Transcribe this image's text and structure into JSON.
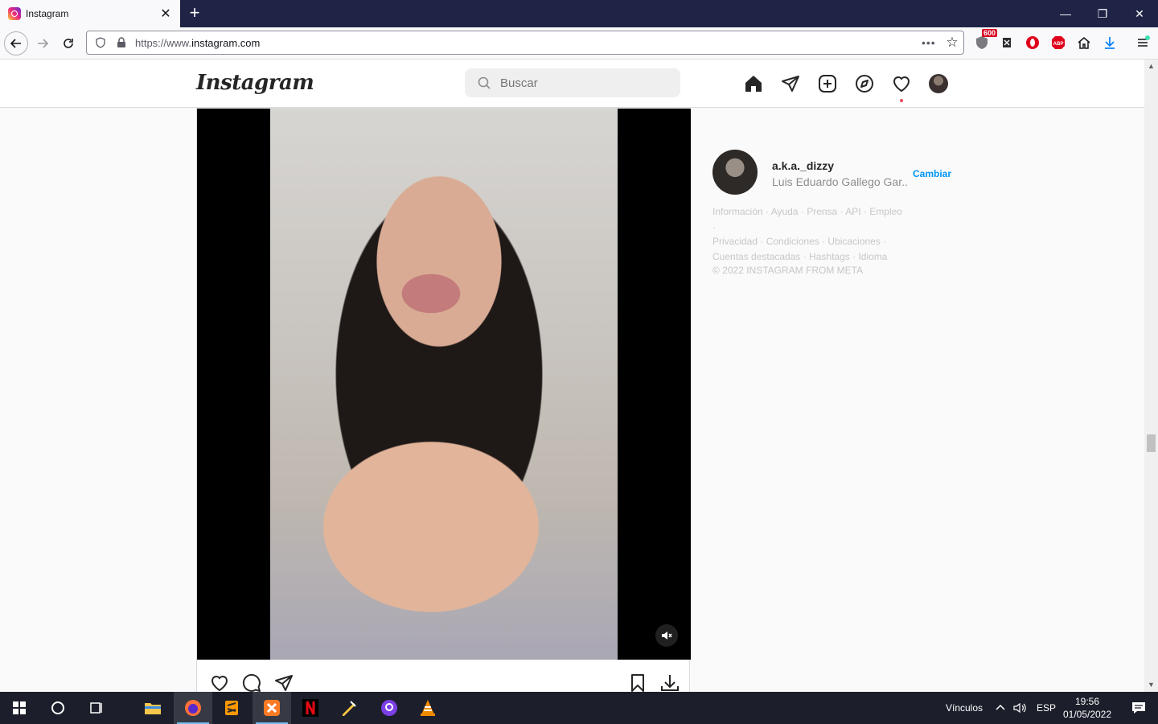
{
  "browser": {
    "tab_title": "Instagram",
    "tab_close": "✕",
    "new_tab": "+",
    "url_prefix": "https://www.",
    "url_domain": "instagram.com",
    "ublock_count": "600",
    "window_minimize": "—",
    "window_restore": "❐",
    "window_close": "✕"
  },
  "instagram": {
    "logo": "Instagram",
    "search_placeholder": "Buscar"
  },
  "sidebar": {
    "username": "a.k.a._dizzy",
    "full_name": "Luis Eduardo Gallego Gar...",
    "switch_label": "Cambiar",
    "footer_links": [
      "Información",
      "Ayuda",
      "Prensa",
      "API",
      "Empleo",
      "Privacidad",
      "Condiciones",
      "Ubicaciones",
      "Cuentas destacadas",
      "Hashtags",
      "Idioma"
    ],
    "copyright": "© 2022 INSTAGRAM FROM META"
  },
  "taskbar": {
    "links_label": "Vínculos",
    "language": "ESP",
    "time": "19:56",
    "date": "01/05/2022"
  },
  "icons": {
    "accent_blue": "#0095f6",
    "notification_red": "#ed4956"
  }
}
